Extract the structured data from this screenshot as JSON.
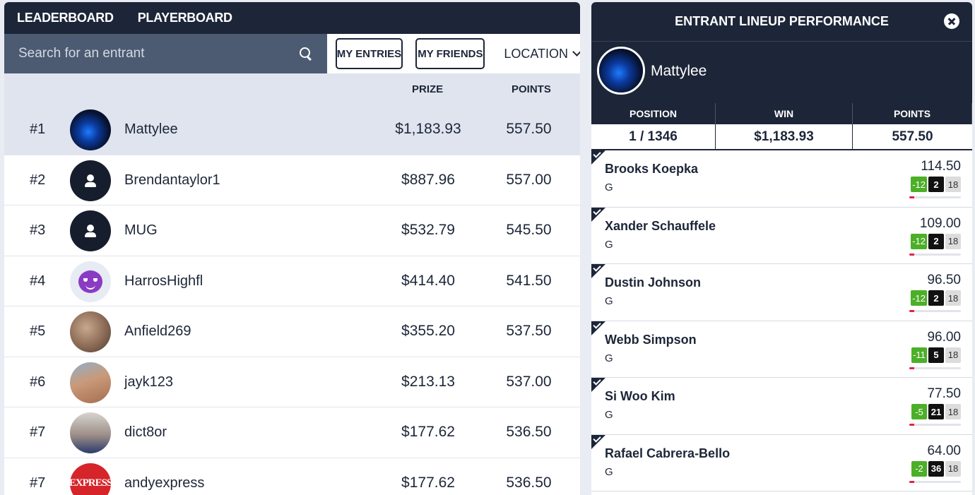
{
  "tabs": [
    {
      "label": "LEADERBOARD"
    },
    {
      "label": "PLAYERBOARD"
    }
  ],
  "search": {
    "placeholder": "Search for an entrant"
  },
  "buttons": {
    "my_entries": "MY ENTRIES",
    "my_friends": "MY FRIENDS",
    "location": "LOCATION"
  },
  "columns": {
    "prize": "PRIZE",
    "points": "POINTS"
  },
  "leaderboard": [
    {
      "rank": "#1",
      "name": "Mattylee",
      "prize": "$1,183.93",
      "points": "557.50",
      "avatar": "pool-photo"
    },
    {
      "rank": "#2",
      "name": "Brendantaylor1",
      "prize": "$887.96",
      "points": "557.00",
      "avatar": "default-user"
    },
    {
      "rank": "#3",
      "name": "MUG",
      "prize": "$532.79",
      "points": "545.50",
      "avatar": "default-user"
    },
    {
      "rank": "#4",
      "name": "HarrosHighfl",
      "prize": "$414.40",
      "points": "541.50",
      "avatar": "devil-emoji"
    },
    {
      "rank": "#5",
      "name": "Anfield269",
      "prize": "$355.20",
      "points": "537.50",
      "avatar": "photo"
    },
    {
      "rank": "#6",
      "name": "jayk123",
      "prize": "$213.13",
      "points": "537.00",
      "avatar": "photo"
    },
    {
      "rank": "#7",
      "name": "dict8or",
      "prize": "$177.62",
      "points": "536.50",
      "avatar": "photo"
    },
    {
      "rank": "#7",
      "name": "andyexpress",
      "prize": "$177.62",
      "points": "536.50",
      "avatar": "express-logo",
      "avatar_text": "EXPRESS"
    }
  ],
  "panel": {
    "title": "ENTRANT LINEUP PERFORMANCE",
    "username": "Mattylee",
    "stats": {
      "position_label": "POSITION",
      "position": "1 / 1346",
      "win_label": "WIN",
      "win": "$1,183.93",
      "points_label": "POINTS",
      "points": "557.50"
    },
    "players": [
      {
        "name": "Brooks Koepka",
        "pos": "G",
        "points": "114.50",
        "score": "-12",
        "place": "2",
        "hole": "18",
        "progress": 0.1
      },
      {
        "name": "Xander Schauffele",
        "pos": "G",
        "points": "109.00",
        "score": "-12",
        "place": "2",
        "hole": "18",
        "progress": 0.1
      },
      {
        "name": "Dustin Johnson",
        "pos": "G",
        "points": "96.50",
        "score": "-12",
        "place": "2",
        "hole": "18",
        "progress": 0.1
      },
      {
        "name": "Webb Simpson",
        "pos": "G",
        "points": "96.00",
        "score": "-11",
        "place": "5",
        "hole": "18",
        "progress": 0.1
      },
      {
        "name": "Si Woo Kim",
        "pos": "G",
        "points": "77.50",
        "score": "-5",
        "place": "21",
        "hole": "18",
        "progress": 0.1
      },
      {
        "name": "Rafael Cabrera-Bello",
        "pos": "G",
        "points": "64.00",
        "score": "-2",
        "place": "36",
        "hole": "18",
        "progress": 0.1
      }
    ]
  },
  "colors": {
    "navy": "#1d2638",
    "slate": "#4c5b72",
    "highlight": "#dfe4ee",
    "score_green": "#4caf28",
    "progress_red": "#e2234a"
  }
}
